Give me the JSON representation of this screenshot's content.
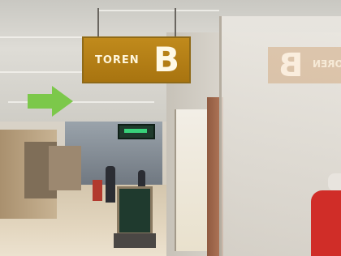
{
  "sign": {
    "text": "TOREN",
    "letter": "B",
    "color": "#b07a14"
  },
  "arrow": {
    "color": "#7cc84a",
    "direction": "right"
  }
}
